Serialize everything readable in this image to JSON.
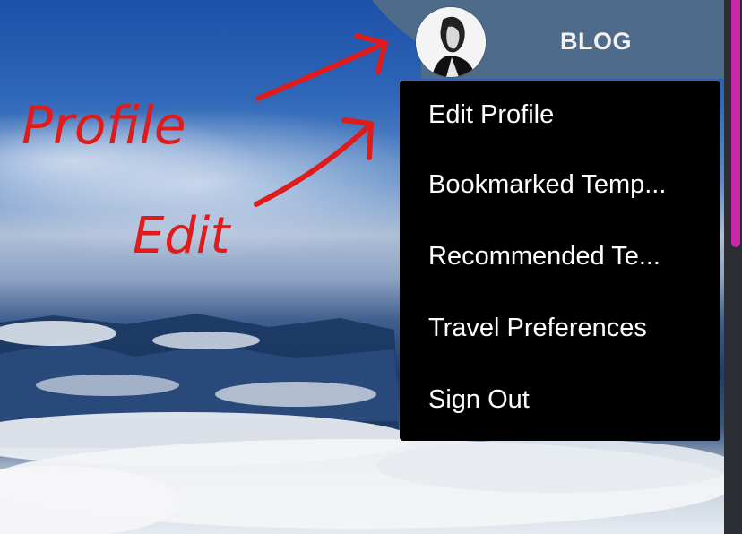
{
  "header": {
    "nav_link": "BLOG",
    "avatar_icon": "user-avatar"
  },
  "dropdown": {
    "items": [
      {
        "label": "Edit Profile"
      },
      {
        "label": "Bookmarked Temp..."
      },
      {
        "label": "Recommended Te..."
      },
      {
        "label": "Travel Preferences"
      },
      {
        "label": "Sign Out"
      }
    ]
  },
  "annotations": {
    "profile_label": "Profile",
    "edit_label": "Edit",
    "color": "#e01b1b"
  },
  "colors": {
    "header": "#4e6b8a",
    "menu_bg": "#000000",
    "scroll_thumb": "#c728a8"
  }
}
